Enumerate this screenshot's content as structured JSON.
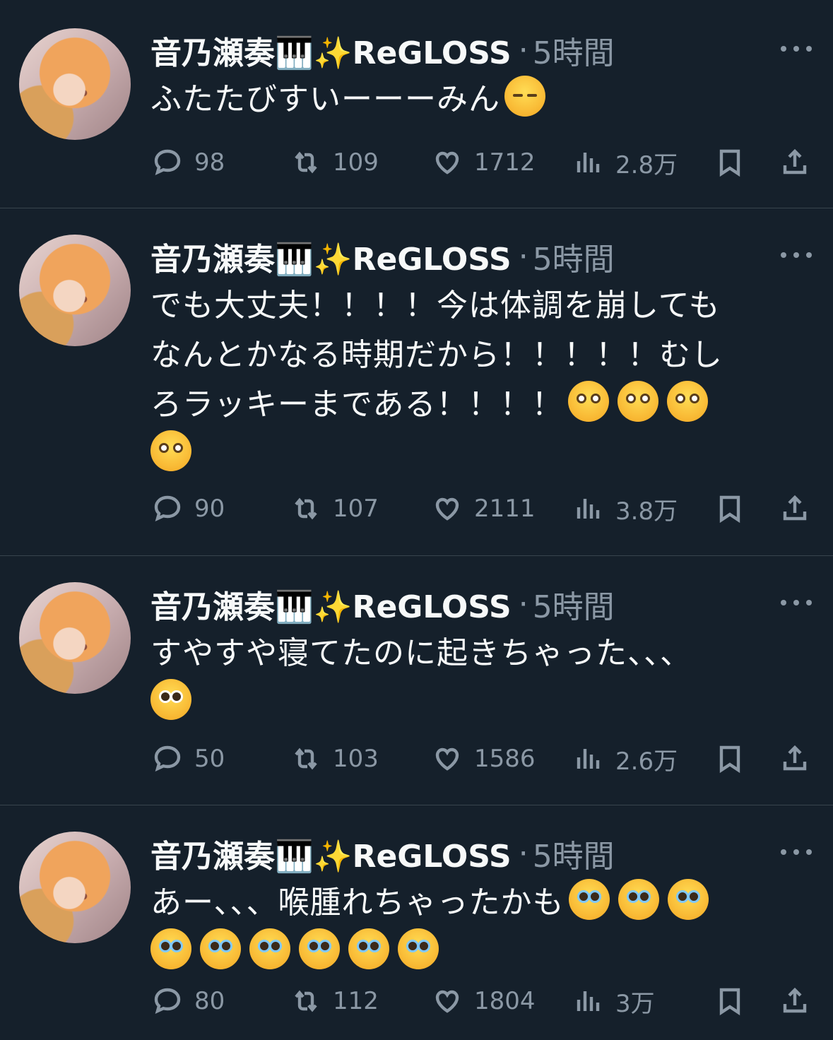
{
  "tweets": [
    {
      "name": "音乃瀬奏🎹✨ReGLOSS",
      "time": "5時間",
      "lines": [
        "ふたたびすいーーーみん"
      ],
      "emoji_after": [
        "sleep"
      ],
      "replies": "98",
      "retweets": "109",
      "likes": "1712",
      "views": "2.8万"
    },
    {
      "name": "音乃瀬奏🎹✨ReGLOSS",
      "time": "5時間",
      "lines": [
        "でも大丈夫！！！！今は体調を崩しても",
        "なんとかなる時期だから！！！！！むし",
        "ろラッキーまである！！！！"
      ],
      "emoji_after": [
        "flushed",
        "flushed",
        "flushed",
        "flushed"
      ],
      "replies": "90",
      "retweets": "107",
      "likes": "2111",
      "views": "3.8万"
    },
    {
      "name": "音乃瀬奏🎹✨ReGLOSS",
      "time": "5時間",
      "lines": [
        "すやすや寝てたのに起きちゃった、、、"
      ],
      "emoji_after": [
        "pleading"
      ],
      "replies": "50",
      "retweets": "103",
      "likes": "1586",
      "views": "2.6万"
    },
    {
      "name": "音乃瀬奏🎹✨ReGLOSS",
      "time": "5時間",
      "lines": [
        "あー、、、喉腫れちゃったかも"
      ],
      "emoji_after": [
        "tear",
        "tear",
        "tear",
        "tear",
        "tear",
        "tear",
        "tear",
        "tear",
        "tear"
      ],
      "replies": "80",
      "retweets": "112",
      "likes": "1804",
      "views": "3万"
    }
  ],
  "icons": {
    "reply": "reply-icon",
    "retweet": "retweet-icon",
    "like": "heart-icon",
    "views": "views-icon",
    "bookmark": "bookmark-icon",
    "share": "share-icon",
    "more": "more-icon"
  }
}
